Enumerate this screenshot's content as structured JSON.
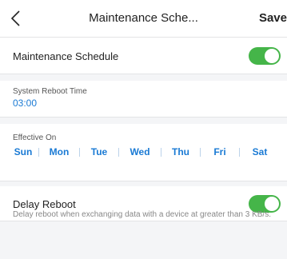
{
  "header": {
    "title": "Maintenance Sche...",
    "save_label": "Save"
  },
  "maintenance": {
    "label": "Maintenance Schedule",
    "enabled": true
  },
  "reboot_time": {
    "label": "System Reboot Time",
    "value": "03:00"
  },
  "effective_on": {
    "label": "Effective On",
    "days": [
      "Sun",
      "Mon",
      "Tue",
      "Wed",
      "Thu",
      "Fri",
      "Sat"
    ]
  },
  "delay_reboot": {
    "label": "Delay Reboot",
    "enabled": true,
    "description": "Delay reboot when exchanging data with a device at greater than 3 KB/s."
  },
  "colors": {
    "accent": "#1a7ad4",
    "toggle_on": "#45b549",
    "background": "#f4f5f7"
  }
}
